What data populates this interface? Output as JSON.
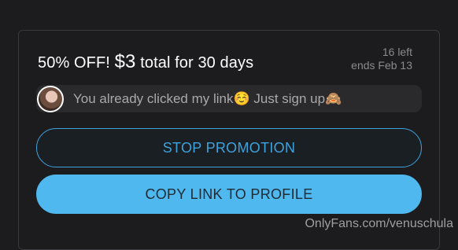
{
  "offer": {
    "discount": "50% OFF!",
    "price": "$3",
    "duration": "total for 30 days",
    "remaining": "16 left",
    "ends": "ends Feb 13"
  },
  "message": {
    "text": "You already clicked my link☺️ Just sign up🙈"
  },
  "buttons": {
    "stop": "STOP PROMOTION",
    "copy": "COPY LINK TO PROFILE"
  },
  "watermark": "OnlyFans.com/venuschula",
  "colors": {
    "accent": "#3ea2dc",
    "copy_button_bg": "#4fb8ee",
    "background": "#1c1c1e"
  }
}
